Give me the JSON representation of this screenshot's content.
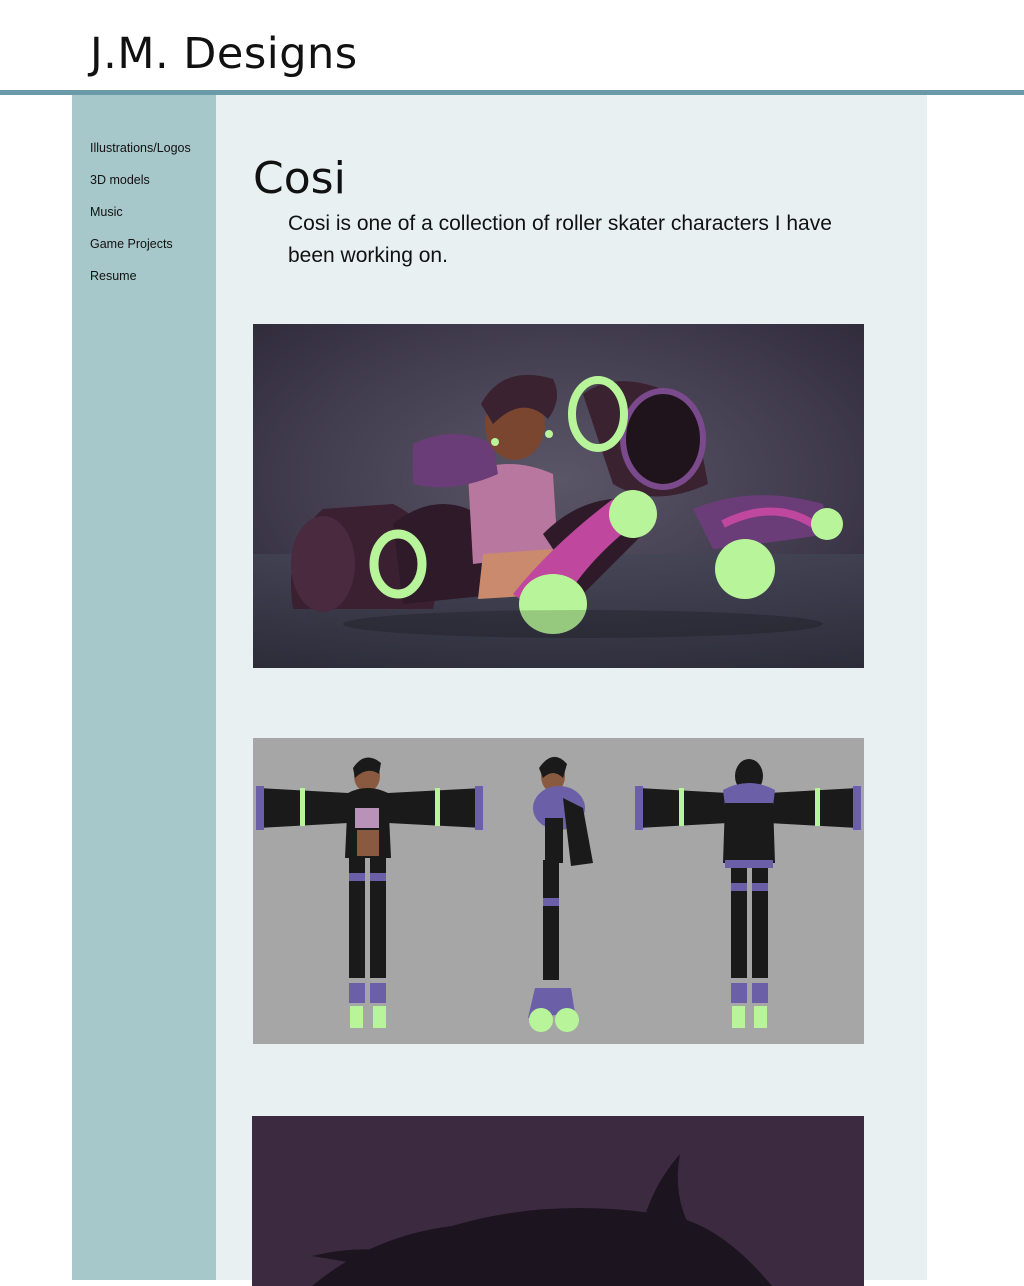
{
  "header": {
    "site_title": "J.M. Designs"
  },
  "sidebar": {
    "items": [
      {
        "label": "Illustrations/Logos"
      },
      {
        "label": "3D models"
      },
      {
        "label": "Music"
      },
      {
        "label": "Game Projects"
      },
      {
        "label": "Resume"
      }
    ]
  },
  "main": {
    "title": "Cosi",
    "intro": "Cosi is one of a collection of roller skater characters I have been working on."
  },
  "colors": {
    "header_rule": "#6a9aa8",
    "sidebar_bg": "#a7c8ca",
    "main_bg": "#e8f0f2",
    "render_bg_dark": "#3b3242",
    "turnaround_bg": "#a6a6a6",
    "accent_green": "#b8f59a",
    "accent_purple": "#7a4a8c"
  }
}
